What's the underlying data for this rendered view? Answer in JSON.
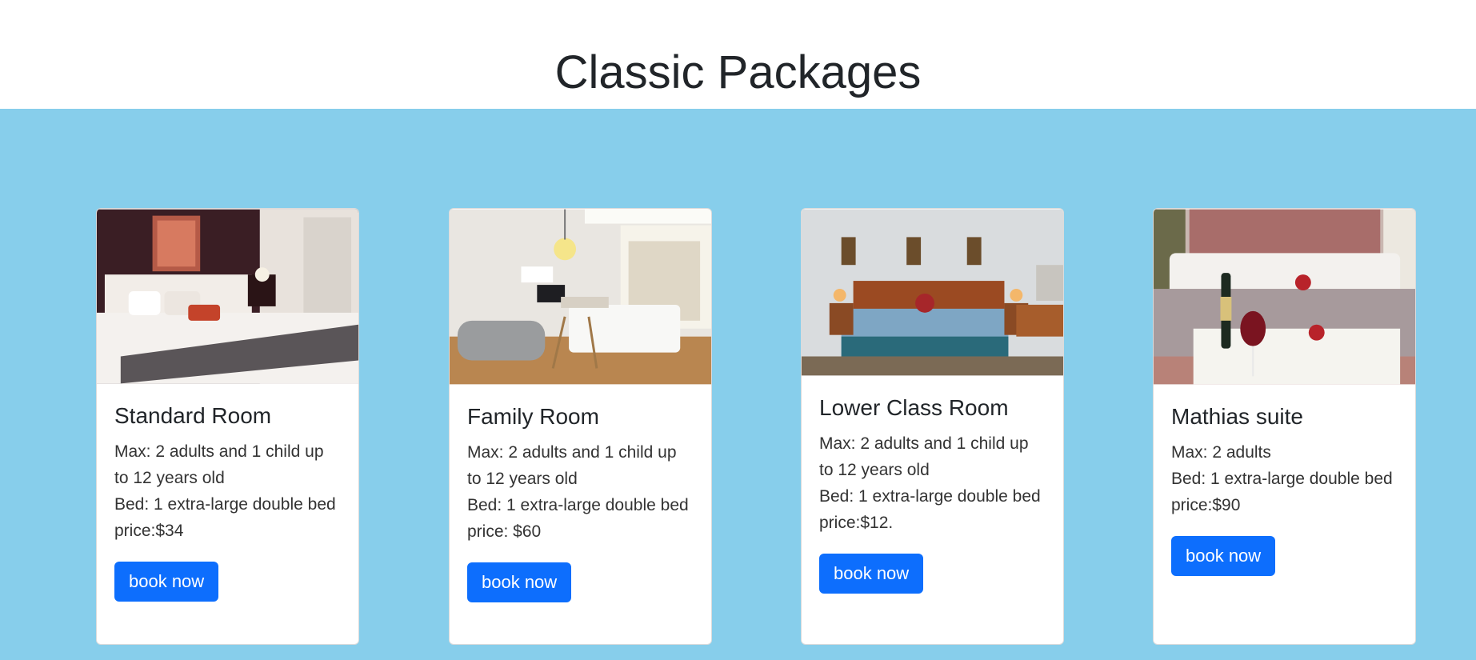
{
  "page": {
    "title": "Classic Packages"
  },
  "colors": {
    "band": "#87ceeb",
    "button": "#0d6efd",
    "text": "#212529"
  },
  "cards": [
    {
      "title": "Standard Room",
      "line1": "Max: 2 adults and 1 child up to 12 years old",
      "line2": "Bed: 1 extra-large double bed",
      "line3": "price:$34",
      "button": "book now",
      "image": "hotel-bedroom-photo"
    },
    {
      "title": "Family Room",
      "line1": "Max: 2 adults and 1 child up to 12 years old",
      "line2": "Bed: 1 extra-large double bed",
      "line3": "price: $60",
      "button": "book now",
      "image": "family-room-photo"
    },
    {
      "title": "Lower Class Room",
      "line1": "Max: 2 adults and 1 child up to 12 years old",
      "line2": "Bed: 1 extra-large double bed",
      "line3": "price:$12.",
      "button": "book now",
      "image": "lower-class-room-photo"
    },
    {
      "title": "Mathias suite",
      "line1": "Max: 2 adults",
      "line2": "Bed: 1 extra-large double bed price:$90",
      "button": "book now",
      "image": "suite-champagne-photo"
    }
  ]
}
